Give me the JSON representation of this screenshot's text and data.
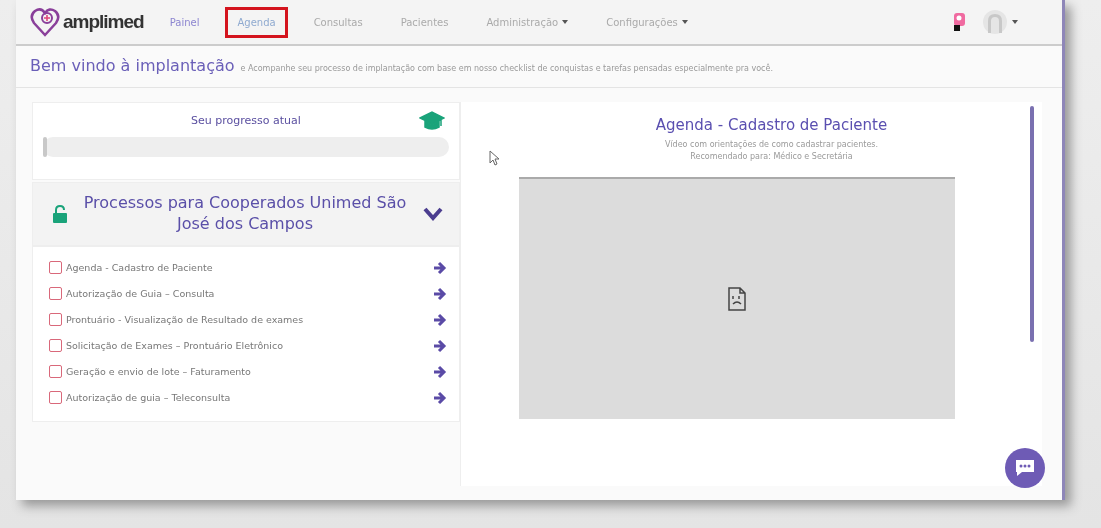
{
  "navbar": {
    "logo": "amplimed",
    "items": [
      {
        "label": "Painel",
        "selected": false,
        "dropdown": false
      },
      {
        "label": "Agenda",
        "selected": true,
        "dropdown": false
      },
      {
        "label": "Consultas",
        "selected": false,
        "dropdown": false
      },
      {
        "label": "Pacientes",
        "selected": false,
        "dropdown": false
      },
      {
        "label": "Administração",
        "selected": false,
        "dropdown": true
      },
      {
        "label": "Configurações",
        "selected": false,
        "dropdown": true
      }
    ]
  },
  "welcome": {
    "title": "Bem vindo à implantação",
    "subtitle": "e Acompanhe seu processo de implantação com base em nosso checklist de conquistas e tarefas pensadas especialmente pra você."
  },
  "progress": {
    "title": "Seu progresso atual",
    "level": 0.01
  },
  "section": {
    "title": "Processos para Cooperados Unimed São José dos Campos",
    "expanded": true,
    "items": [
      {
        "label": "Agenda - Cadastro de Paciente",
        "checked": false
      },
      {
        "label": "Autorização de Guia – Consulta",
        "checked": false
      },
      {
        "label": "Prontuário - Visualização de Resultado de exames",
        "checked": false
      },
      {
        "label": "Solicitação de Exames – Prontuário Eletrônico",
        "checked": false
      },
      {
        "label": "Geração e envio de lote – Faturamento",
        "checked": false
      },
      {
        "label": "Autorização de guia – Teleconsulta",
        "checked": false
      }
    ]
  },
  "detail": {
    "title": "Agenda - Cadastro de Paciente",
    "description": "Vídeo com orientações de como cadastrar pacientes.",
    "recommended": "Recomendado para: Médico e Secretária"
  }
}
